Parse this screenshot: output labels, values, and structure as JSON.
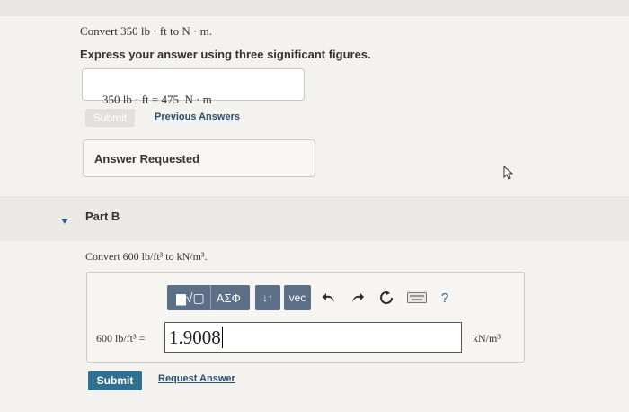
{
  "partA": {
    "prompt": "Convert 350 lb · ft to N · m.",
    "instruction": "Express your answer using three significant figures.",
    "answer_lhs": "350 lb · ft = ",
    "answer_value": "475",
    "answer_unit": "N · m",
    "submit_label": "Submit",
    "previous_answers_label": "Previous Answers",
    "feedback": "Answer Requested"
  },
  "partB": {
    "header": "Part B",
    "prompt": "Convert 600 lb/ft³ to kN/m³.",
    "toolbar": {
      "templates_label": "▆√▢",
      "greek_label": "ΑΣΦ",
      "arrows_label": "↓↑",
      "vec_label": "vec",
      "help_label": "?"
    },
    "input_lhs": "600 lb/ft³ = ",
    "input_value": "1.9008",
    "input_unit": "kN/m³",
    "submit_label": "Submit",
    "request_answer_label": "Request Answer"
  },
  "icons": {
    "collapse": "caret-down-icon",
    "undo": "undo-icon",
    "redo": "redo-icon",
    "reset": "reset-icon",
    "keyboard": "keyboard-icon",
    "cursor": "mouse-cursor-icon"
  },
  "colors": {
    "submit_bg": "#2f6f8f",
    "toolbar_bg": "#5c6f86",
    "link": "#2a4f6e"
  }
}
